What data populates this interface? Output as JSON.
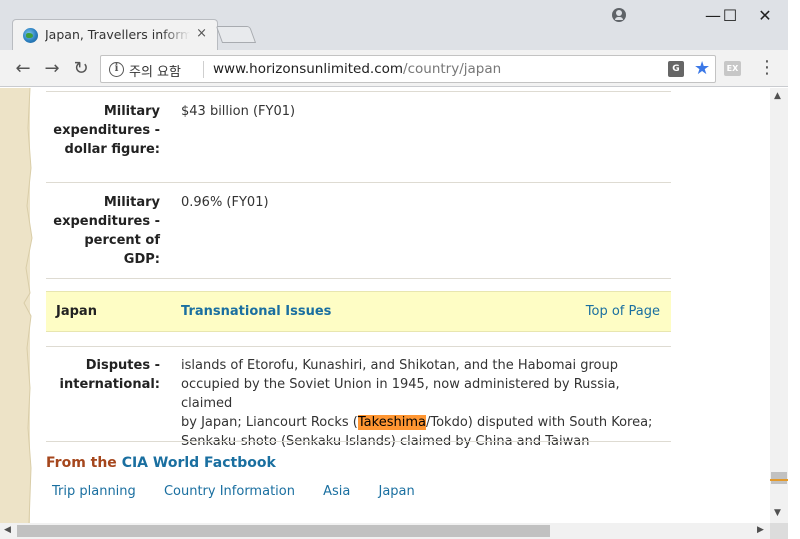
{
  "browser": {
    "tab_title": "Japan, Travellers information",
    "tab_close": "×",
    "security_label": "주의 요함",
    "url_host": "www.horizonsunlimited.com",
    "url_path": "/country/japan",
    "ext_label": "EX",
    "translate_label": "G",
    "info_glyph": "i",
    "window_controls": {
      "minimize": "—",
      "maximize": "☐",
      "close": "✕"
    }
  },
  "rows": [
    {
      "label_lines": [
        "Military",
        "expenditures -",
        "dollar figure:"
      ],
      "value": "$43 billion (FY01)"
    },
    {
      "label_lines": [
        "Military",
        "expenditures -",
        "percent of",
        "GDP:"
      ],
      "value": "0.96% (FY01)"
    }
  ],
  "section": {
    "country": "Japan",
    "title": "Transnational Issues",
    "top_link": "Top of Page"
  },
  "disputes": {
    "label_lines": [
      "Disputes -",
      "international:"
    ],
    "line1": "islands of Etorofu, Kunashiri, and Shikotan, and the Habomai group",
    "line2": "occupied by the Soviet Union in 1945, now administered by Russia, claimed",
    "line3_before": "by Japan; Liancourt Rocks (",
    "line3_highlight": "Takeshima",
    "line3_after": "/Tokdo) disputed with South Korea;",
    "line4": "Senkaku-shoto (Senkaku Islands) claimed by China and Taiwan"
  },
  "source": {
    "prefix": "From the ",
    "link": "CIA World Factbook"
  },
  "crumbs": [
    "Trip planning",
    "Country Information",
    "Asia",
    "Japan"
  ],
  "scroll_arrows": {
    "up": "▲",
    "down": "▼",
    "left": "◀",
    "right": "▶"
  }
}
